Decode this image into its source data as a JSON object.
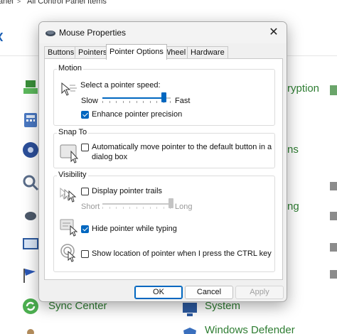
{
  "background": {
    "breadcrumb": {
      "part1": "anel",
      "separator": ">",
      "part2": "All Control Panel Items"
    },
    "left_column": {
      "labels": [
        "Sync Center"
      ]
    },
    "right_column": {
      "labels": [
        "ryption",
        "ns",
        "ng",
        "System",
        "Windows Defender"
      ]
    },
    "label_color": "#2e7d32"
  },
  "dialog": {
    "title": "Mouse Properties",
    "close_icon": "close-icon",
    "tabs": [
      {
        "label": "Buttons",
        "active": false
      },
      {
        "label": "Pointers",
        "active": false
      },
      {
        "label": "Pointer Options",
        "active": true
      },
      {
        "label": "Wheel",
        "active": false
      },
      {
        "label": "Hardware",
        "active": false
      }
    ],
    "motion": {
      "title": "Motion",
      "speed_label": "Select a pointer speed:",
      "slow_label": "Slow",
      "fast_label": "Fast",
      "speed_level": 0.9,
      "enhance_label": "Enhance pointer precision",
      "enhance_checked": true
    },
    "snap_to": {
      "title": "Snap To",
      "snap_label_line1": "Automatically move pointer to the default button in a",
      "snap_label_line2": "dialog box",
      "snap_checked": false
    },
    "visibility": {
      "title": "Visibility",
      "trails_label": "Display pointer trails",
      "trails_checked": false,
      "short_label": "Short",
      "long_label": "Long",
      "trail_level": 1.0,
      "trail_enabled": false,
      "hide_label": "Hide pointer while typing",
      "hide_checked": true,
      "ctrl_label": "Show location of pointer when I press the CTRL key",
      "ctrl_checked": false
    },
    "buttons": {
      "ok": "OK",
      "cancel": "Cancel",
      "apply": "Apply"
    },
    "accent_color": "#0067c0"
  }
}
